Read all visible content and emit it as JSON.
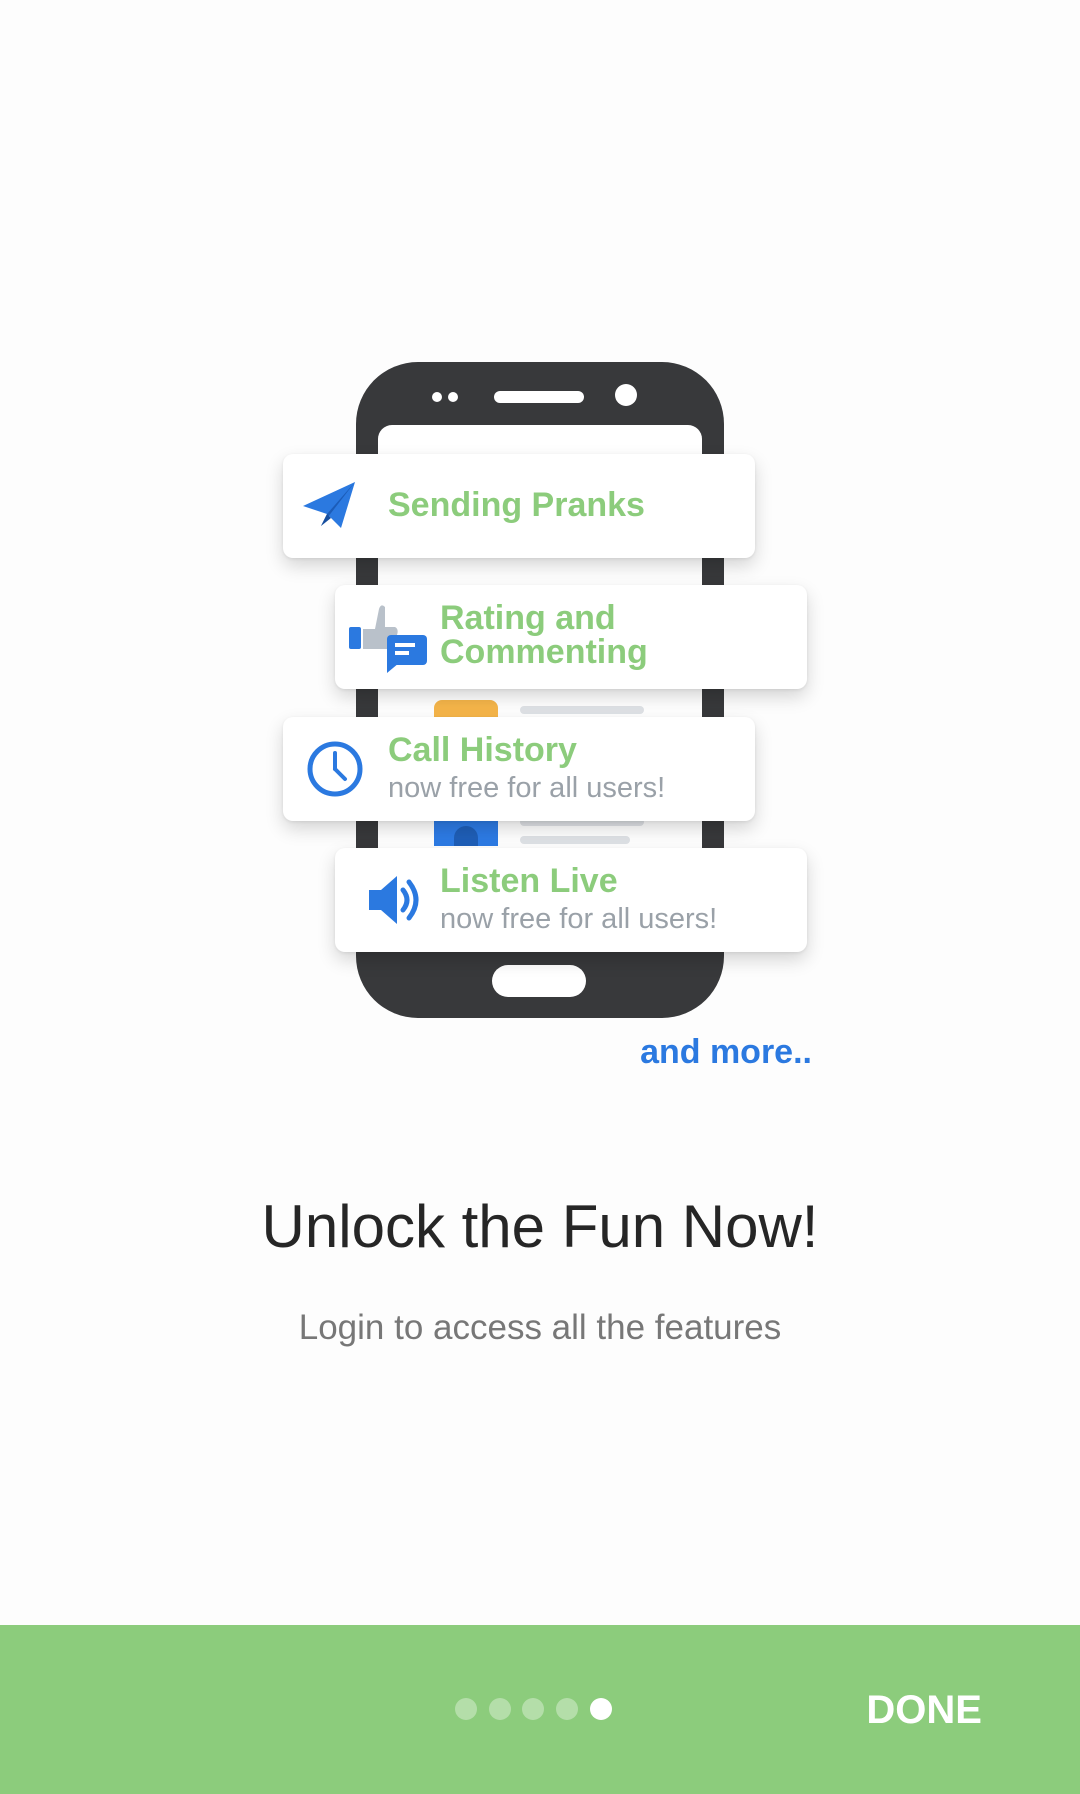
{
  "features": [
    {
      "icon": "paper-plane-icon",
      "title": "Sending Pranks",
      "subtitle": ""
    },
    {
      "icon": "thumbs-up-comment-icon",
      "title_line1": "Rating and",
      "title_line2": "Commenting"
    },
    {
      "icon": "clock-icon",
      "title": "Call History",
      "subtitle": "now free for all users!"
    },
    {
      "icon": "speaker-icon",
      "title": "Listen Live",
      "subtitle": "now free for all users!"
    }
  ],
  "and_more": "and more..",
  "headline": "Unlock the Fun Now!",
  "subheadline": "Login to access all the features",
  "footer": {
    "done_label": "DONE",
    "page_count": 5,
    "active_page": 5
  },
  "colors": {
    "accent_green": "#8ccc7c",
    "accent_blue": "#2b79e0",
    "phone_body": "#38393b"
  }
}
